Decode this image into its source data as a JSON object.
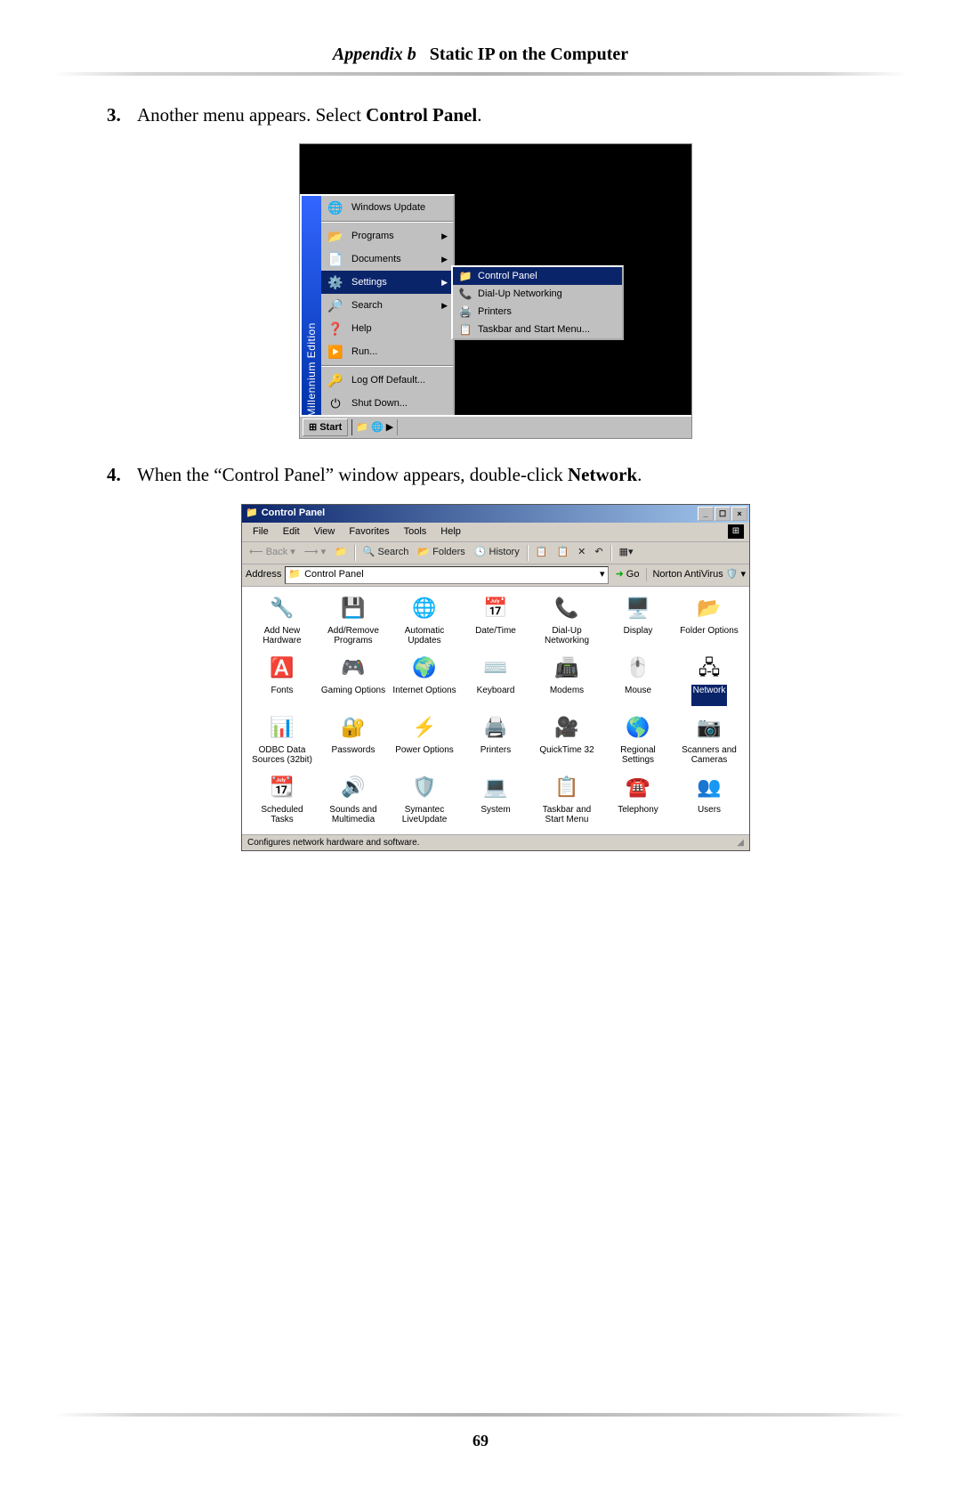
{
  "header": {
    "appendix": "Appendix b",
    "title": "Static IP on the Computer"
  },
  "pagenum": "69",
  "steps": {
    "s3": {
      "text_a": "Another menu appears. Select ",
      "bold": "Control Panel",
      "text_b": "."
    },
    "s4": {
      "text_a": "When the “Control Panel” window appears, double-click ",
      "bold": "Network",
      "text_b": "."
    }
  },
  "fig1": {
    "sidetext": "Windows Me Millennium Edition",
    "items": [
      {
        "icon": "🌐",
        "label": "Windows Update",
        "arrow": false,
        "sel": false,
        "sep": true
      },
      {
        "icon": "📂",
        "label": "Programs",
        "arrow": true,
        "sel": false
      },
      {
        "icon": "📄",
        "label": "Documents",
        "arrow": true,
        "sel": false
      },
      {
        "icon": "⚙️",
        "label": "Settings",
        "arrow": true,
        "sel": true
      },
      {
        "icon": "🔎",
        "label": "Search",
        "arrow": true,
        "sel": false
      },
      {
        "icon": "❓",
        "label": "Help",
        "arrow": false,
        "sel": false
      },
      {
        "icon": "▶️",
        "label": "Run...",
        "arrow": false,
        "sel": false,
        "sep": true
      },
      {
        "icon": "🔑",
        "label": "Log Off Default...",
        "arrow": false,
        "sel": false
      },
      {
        "icon": "⏻",
        "label": "Shut Down...",
        "arrow": false,
        "sel": false
      }
    ],
    "submenu": [
      {
        "icon": "📁",
        "label": "Control Panel",
        "sel": true
      },
      {
        "icon": "📞",
        "label": "Dial-Up Networking",
        "sel": false
      },
      {
        "icon": "🖨️",
        "label": "Printers",
        "sel": false
      },
      {
        "icon": "📋",
        "label": "Taskbar and Start Menu...",
        "sel": false
      }
    ],
    "taskbar": {
      "start": "Start",
      "tray": [
        "📁",
        "🌐",
        "▶"
      ]
    }
  },
  "fig2": {
    "title": "Control Panel",
    "menu": [
      "File",
      "Edit",
      "View",
      "Favorites",
      "Tools",
      "Help"
    ],
    "toolbar": {
      "back": "Back",
      "search": "Search",
      "folders": "Folders",
      "history": "History"
    },
    "addr": {
      "label": "Address",
      "value": "Control Panel",
      "go": "Go",
      "nav": "Norton AntiVirus"
    },
    "items": [
      {
        "icon": "🔧",
        "label": "Add New Hardware"
      },
      {
        "icon": "💾",
        "label": "Add/Remove Programs"
      },
      {
        "icon": "🌐",
        "label": "Automatic Updates"
      },
      {
        "icon": "📅",
        "label": "Date/Time"
      },
      {
        "icon": "📞",
        "label": "Dial-Up Networking"
      },
      {
        "icon": "🖥️",
        "label": "Display"
      },
      {
        "icon": "📂",
        "label": "Folder Options"
      },
      {
        "icon": "🅰️",
        "label": "Fonts"
      },
      {
        "icon": "🎮",
        "label": "Gaming Options"
      },
      {
        "icon": "🌍",
        "label": "Internet Options"
      },
      {
        "icon": "⌨️",
        "label": "Keyboard"
      },
      {
        "icon": "📠",
        "label": "Modems"
      },
      {
        "icon": "🖱️",
        "label": "Mouse"
      },
      {
        "icon": "🖧",
        "label": "Network",
        "sel": true
      },
      {
        "icon": "📊",
        "label": "ODBC Data Sources (32bit)"
      },
      {
        "icon": "🔐",
        "label": "Passwords"
      },
      {
        "icon": "⚡",
        "label": "Power Options"
      },
      {
        "icon": "🖨️",
        "label": "Printers"
      },
      {
        "icon": "🎥",
        "label": "QuickTime 32"
      },
      {
        "icon": "🌎",
        "label": "Regional Settings"
      },
      {
        "icon": "📷",
        "label": "Scanners and Cameras"
      },
      {
        "icon": "📆",
        "label": "Scheduled Tasks"
      },
      {
        "icon": "🔊",
        "label": "Sounds and Multimedia"
      },
      {
        "icon": "🛡️",
        "label": "Symantec LiveUpdate"
      },
      {
        "icon": "💻",
        "label": "System"
      },
      {
        "icon": "📋",
        "label": "Taskbar and Start Menu"
      },
      {
        "icon": "☎️",
        "label": "Telephony"
      },
      {
        "icon": "👥",
        "label": "Users"
      }
    ],
    "status": "Configures network hardware and software."
  }
}
